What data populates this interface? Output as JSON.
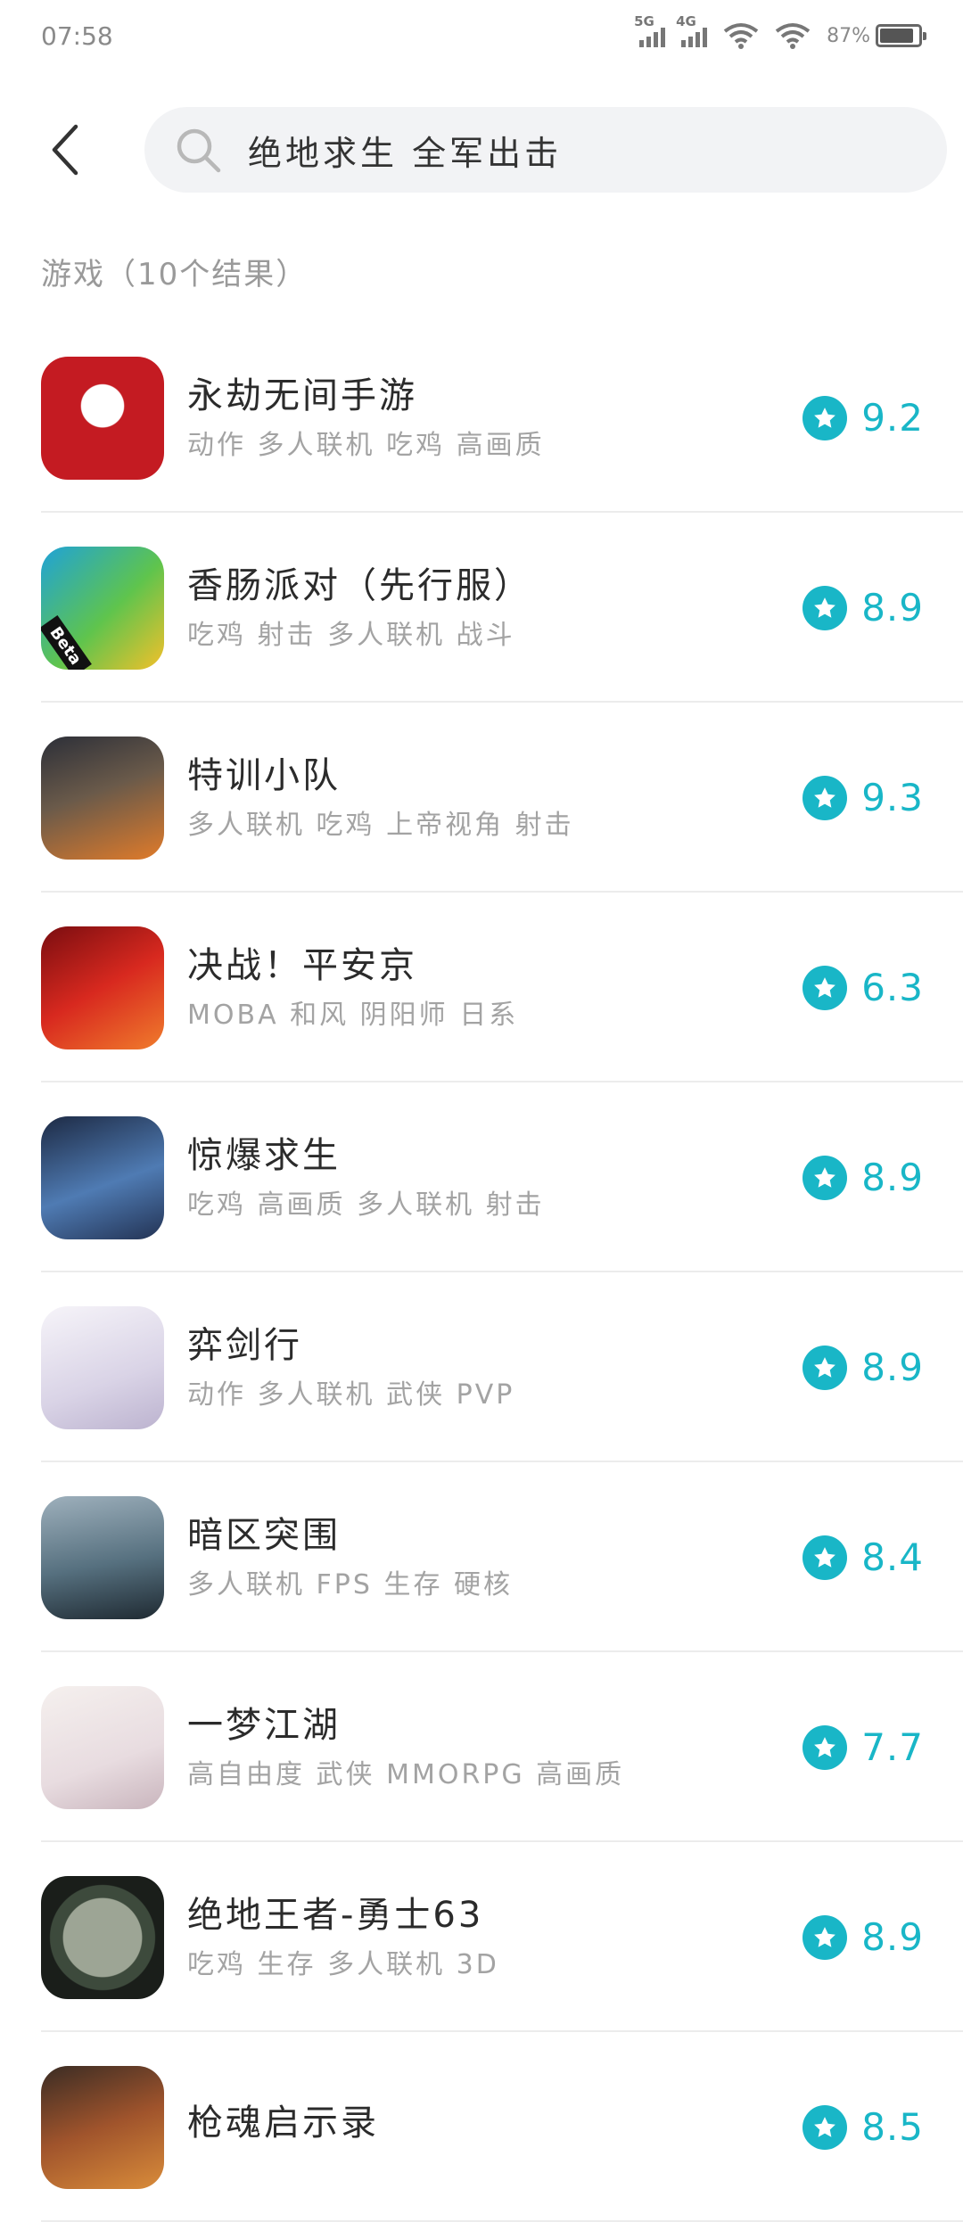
{
  "status_bar": {
    "time": "07:58",
    "net1": "5G",
    "net2": "4G",
    "battery": "87%"
  },
  "search": {
    "query": "绝地求生 全军出击"
  },
  "section": {
    "label": "游戏（10个结果）"
  },
  "colors": {
    "accent": "#19b6c7",
    "search_bg": "#f2f3f5",
    "tag_text": "#a3a3a3"
  },
  "results": [
    {
      "name": "永劫无间手游",
      "tags": "动作 多人联机 吃鸡 高画质",
      "score": "9.2",
      "icon": "yongjie-icon"
    },
    {
      "name": "香肠派对（先行服）",
      "tags": "吃鸡 射击 多人联机 战斗",
      "score": "8.9",
      "icon": "sausage-party-icon"
    },
    {
      "name": "特训小队",
      "tags": "多人联机 吃鸡 上帝视角 射击",
      "score": "9.3",
      "icon": "special-squad-icon"
    },
    {
      "name": "决战！平安京",
      "tags": "MOBA 和风 阴阳师 日系",
      "score": "6.3",
      "icon": "heian-kyo-icon"
    },
    {
      "name": "惊爆求生",
      "tags": "吃鸡 高画质 多人联机 射击",
      "score": "8.9",
      "icon": "survival-icon"
    },
    {
      "name": "弈剑行",
      "tags": "动作 多人联机 武侠 PVP",
      "score": "8.9",
      "icon": "sword-icon"
    },
    {
      "name": "暗区突围",
      "tags": "多人联机 FPS 生存 硬核",
      "score": "8.4",
      "icon": "arena-breakout-icon"
    },
    {
      "name": "一梦江湖",
      "tags": "高自由度 武侠 MMORPG 高画质",
      "score": "7.7",
      "icon": "jianghu-icon"
    },
    {
      "name": "绝地王者-勇士63",
      "tags": "吃鸡 生存 多人联机 3D",
      "score": "8.9",
      "icon": "warrior-scope-icon"
    },
    {
      "name": "枪魂启示录",
      "tags": "",
      "score": "8.5",
      "icon": "gun-soul-icon"
    }
  ]
}
